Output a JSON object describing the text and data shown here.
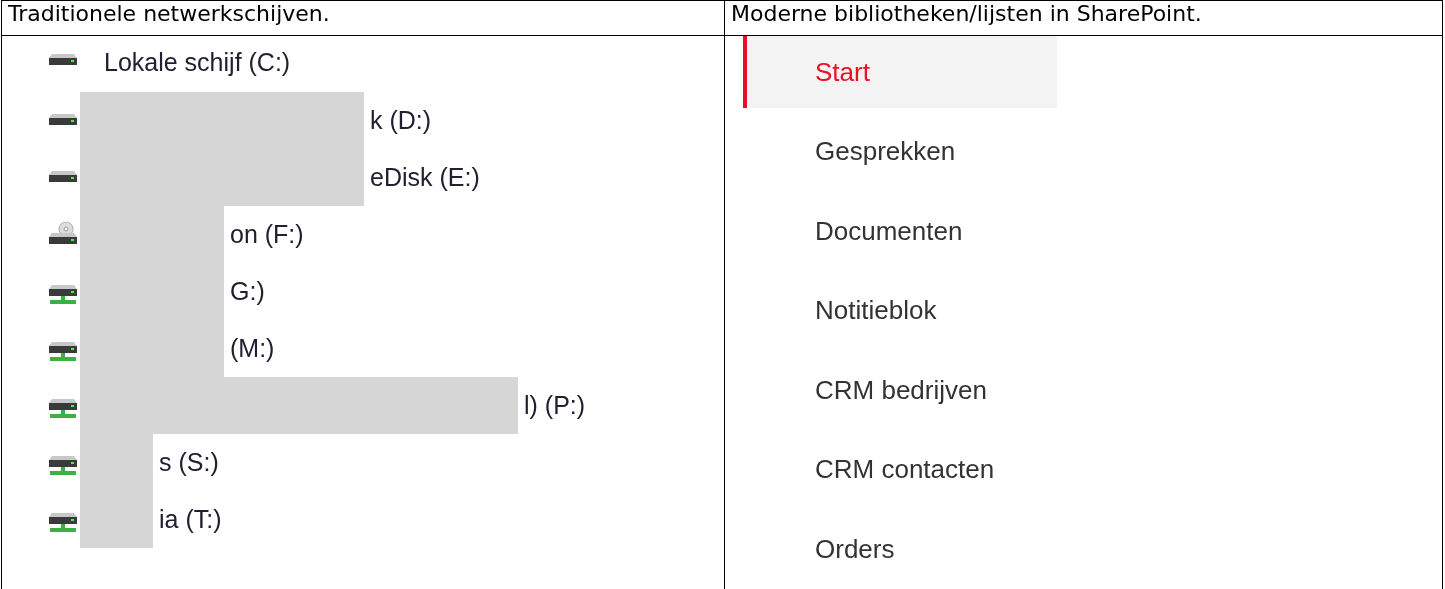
{
  "table": {
    "columns": [
      "Traditionele netwerkschijven.",
      "Moderne bibliotheken/lijsten in SharePoint."
    ]
  },
  "drives": [
    {
      "kind": "local",
      "label": "Lokale schijf (C:)",
      "redacted": false
    },
    {
      "kind": "local",
      "label": "k (D:)",
      "redacted": true
    },
    {
      "kind": "local",
      "label": "eDisk (E:)",
      "redacted": true
    },
    {
      "kind": "optical",
      "label": "on (F:)",
      "redacted": true
    },
    {
      "kind": "network",
      "label": "G:)",
      "redacted": true
    },
    {
      "kind": "network",
      "label": "(M:)",
      "redacted": true
    },
    {
      "kind": "network",
      "label": "l) (P:)",
      "redacted": true
    },
    {
      "kind": "network",
      "label": "s (S:)",
      "redacted": true
    },
    {
      "kind": "network",
      "label": "ia (T:)",
      "redacted": true
    }
  ],
  "nav": [
    {
      "label": "Start",
      "selected": true
    },
    {
      "label": "Gesprekken",
      "selected": false
    },
    {
      "label": "Documenten",
      "selected": false
    },
    {
      "label": "Notitieblok",
      "selected": false
    },
    {
      "label": "CRM bedrijven",
      "selected": false
    },
    {
      "label": "CRM contacten",
      "selected": false
    },
    {
      "label": "Orders",
      "selected": false
    }
  ]
}
